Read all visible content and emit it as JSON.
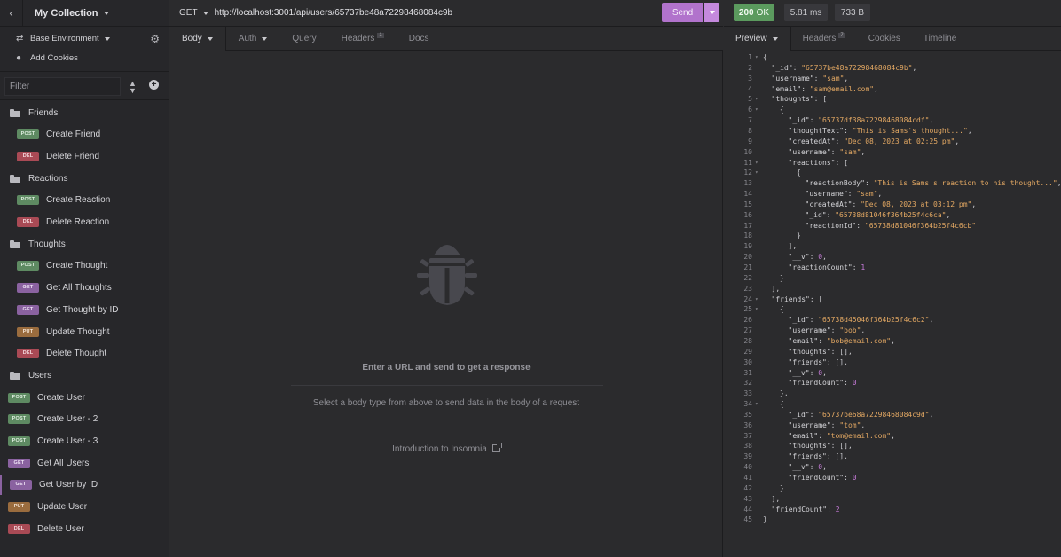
{
  "sidebar": {
    "collection_title": "My Collection",
    "environment_label": "Base Environment",
    "add_cookies_label": "Add Cookies",
    "filter_placeholder": "Filter",
    "items": [
      {
        "type": "folder",
        "label": "Friends"
      },
      {
        "type": "request",
        "method": "POST",
        "label": "Create Friend",
        "indent": true
      },
      {
        "type": "request",
        "method": "DEL",
        "label": "Delete Friend",
        "indent": true
      },
      {
        "type": "folder",
        "label": "Reactions"
      },
      {
        "type": "request",
        "method": "POST",
        "label": "Create Reaction",
        "indent": true
      },
      {
        "type": "request",
        "method": "DEL",
        "label": "Delete Reaction",
        "indent": true
      },
      {
        "type": "folder",
        "label": "Thoughts"
      },
      {
        "type": "request",
        "method": "POST",
        "label": "Create Thought",
        "indent": true
      },
      {
        "type": "request",
        "method": "GET",
        "label": "Get All Thoughts",
        "indent": true
      },
      {
        "type": "request",
        "method": "GET",
        "label": "Get Thought by ID",
        "indent": true
      },
      {
        "type": "request",
        "method": "PUT",
        "label": "Update Thought",
        "indent": true
      },
      {
        "type": "request",
        "method": "DEL",
        "label": "Delete Thought",
        "indent": true
      },
      {
        "type": "folder",
        "label": "Users"
      },
      {
        "type": "request",
        "method": "POST",
        "label": "Create User",
        "indent": false
      },
      {
        "type": "request",
        "method": "POST",
        "label": "Create User - 2",
        "indent": false
      },
      {
        "type": "request",
        "method": "POST",
        "label": "Create User - 3",
        "indent": false
      },
      {
        "type": "request",
        "method": "GET",
        "label": "Get All Users",
        "indent": false
      },
      {
        "type": "request",
        "method": "GET",
        "label": "Get User by ID",
        "indent": false,
        "active": true
      },
      {
        "type": "request",
        "method": "PUT",
        "label": "Update User",
        "indent": false
      },
      {
        "type": "request",
        "method": "DEL",
        "label": "Delete User",
        "indent": false
      }
    ]
  },
  "request": {
    "method": "GET",
    "url": "http://localhost:3001/api/users/65737be48a72298468084c9b",
    "send_label": "Send",
    "tabs": [
      {
        "label": "Body",
        "active": true,
        "dropdown": true
      },
      {
        "label": "Auth",
        "active": false,
        "dropdown": true
      },
      {
        "label": "Query",
        "active": false
      },
      {
        "label": "Headers",
        "active": false,
        "count": "1"
      },
      {
        "label": "Docs",
        "active": false
      }
    ],
    "empty_title": "Enter a URL and send to get a response",
    "empty_sub": "Select a body type from above to send data in the body of a request",
    "intro_link": "Introduction to Insomnia"
  },
  "response": {
    "status_code": "200",
    "status_text": "OK",
    "time": "5.81 ms",
    "size": "733 B",
    "tabs": [
      {
        "label": "Preview",
        "active": true,
        "dropdown": true
      },
      {
        "label": "Headers",
        "active": false,
        "count": "7"
      },
      {
        "label": "Cookies",
        "active": false
      },
      {
        "label": "Timeline",
        "active": false
      }
    ],
    "lines": [
      {
        "n": 1,
        "fold": true,
        "ind": 0,
        "parts": [
          [
            "p",
            "{"
          ]
        ]
      },
      {
        "n": 2,
        "ind": 1,
        "parts": [
          [
            "k",
            "\"_id\""
          ],
          [
            "p",
            ": "
          ],
          [
            "s",
            "\"65737be48a72298468084c9b\""
          ],
          [
            "p",
            ","
          ]
        ]
      },
      {
        "n": 3,
        "ind": 1,
        "parts": [
          [
            "k",
            "\"username\""
          ],
          [
            "p",
            ": "
          ],
          [
            "s",
            "\"sam\""
          ],
          [
            "p",
            ","
          ]
        ]
      },
      {
        "n": 4,
        "ind": 1,
        "parts": [
          [
            "k",
            "\"email\""
          ],
          [
            "p",
            ": "
          ],
          [
            "s",
            "\"sam@email.com\""
          ],
          [
            "p",
            ","
          ]
        ]
      },
      {
        "n": 5,
        "fold": true,
        "ind": 1,
        "parts": [
          [
            "k",
            "\"thoughts\""
          ],
          [
            "p",
            ": ["
          ]
        ]
      },
      {
        "n": 6,
        "fold": true,
        "ind": 2,
        "parts": [
          [
            "p",
            "{"
          ]
        ]
      },
      {
        "n": 7,
        "ind": 3,
        "parts": [
          [
            "k",
            "\"_id\""
          ],
          [
            "p",
            ": "
          ],
          [
            "s",
            "\"65737df38a72298468084cdf\""
          ],
          [
            "p",
            ","
          ]
        ]
      },
      {
        "n": 8,
        "ind": 3,
        "parts": [
          [
            "k",
            "\"thoughtText\""
          ],
          [
            "p",
            ": "
          ],
          [
            "s",
            "\"This is Sams's thought...\""
          ],
          [
            "p",
            ","
          ]
        ]
      },
      {
        "n": 9,
        "ind": 3,
        "parts": [
          [
            "k",
            "\"createdAt\""
          ],
          [
            "p",
            ": "
          ],
          [
            "s",
            "\"Dec 08, 2023 at 02:25 pm\""
          ],
          [
            "p",
            ","
          ]
        ]
      },
      {
        "n": 10,
        "ind": 3,
        "parts": [
          [
            "k",
            "\"username\""
          ],
          [
            "p",
            ": "
          ],
          [
            "s",
            "\"sam\""
          ],
          [
            "p",
            ","
          ]
        ]
      },
      {
        "n": 11,
        "fold": true,
        "ind": 3,
        "parts": [
          [
            "k",
            "\"reactions\""
          ],
          [
            "p",
            ": ["
          ]
        ]
      },
      {
        "n": 12,
        "fold": true,
        "ind": 4,
        "parts": [
          [
            "p",
            "{"
          ]
        ]
      },
      {
        "n": 13,
        "ind": 5,
        "parts": [
          [
            "k",
            "\"reactionBody\""
          ],
          [
            "p",
            ": "
          ],
          [
            "s",
            "\"This is Sams's reaction to his thought...\""
          ],
          [
            "p",
            ","
          ]
        ]
      },
      {
        "n": 14,
        "ind": 5,
        "parts": [
          [
            "k",
            "\"username\""
          ],
          [
            "p",
            ": "
          ],
          [
            "s",
            "\"sam\""
          ],
          [
            "p",
            ","
          ]
        ]
      },
      {
        "n": 15,
        "ind": 5,
        "parts": [
          [
            "k",
            "\"createdAt\""
          ],
          [
            "p",
            ": "
          ],
          [
            "s",
            "\"Dec 08, 2023 at 03:12 pm\""
          ],
          [
            "p",
            ","
          ]
        ]
      },
      {
        "n": 16,
        "ind": 5,
        "parts": [
          [
            "k",
            "\"_id\""
          ],
          [
            "p",
            ": "
          ],
          [
            "s",
            "\"65738d81046f364b25f4c6ca\""
          ],
          [
            "p",
            ","
          ]
        ]
      },
      {
        "n": 17,
        "ind": 5,
        "parts": [
          [
            "k",
            "\"reactionId\""
          ],
          [
            "p",
            ": "
          ],
          [
            "s",
            "\"65738d81046f364b25f4c6cb\""
          ]
        ]
      },
      {
        "n": 18,
        "ind": 4,
        "parts": [
          [
            "p",
            "}"
          ]
        ]
      },
      {
        "n": 19,
        "ind": 3,
        "parts": [
          [
            "p",
            "],"
          ]
        ]
      },
      {
        "n": 20,
        "ind": 3,
        "parts": [
          [
            "k",
            "\"__v\""
          ],
          [
            "p",
            ": "
          ],
          [
            "n",
            "0"
          ],
          [
            "p",
            ","
          ]
        ]
      },
      {
        "n": 21,
        "ind": 3,
        "parts": [
          [
            "k",
            "\"reactionCount\""
          ],
          [
            "p",
            ": "
          ],
          [
            "n",
            "1"
          ]
        ]
      },
      {
        "n": 22,
        "ind": 2,
        "parts": [
          [
            "p",
            "}"
          ]
        ]
      },
      {
        "n": 23,
        "ind": 1,
        "parts": [
          [
            "p",
            "],"
          ]
        ]
      },
      {
        "n": 24,
        "fold": true,
        "ind": 1,
        "parts": [
          [
            "k",
            "\"friends\""
          ],
          [
            "p",
            ": ["
          ]
        ]
      },
      {
        "n": 25,
        "fold": true,
        "ind": 2,
        "parts": [
          [
            "p",
            "{"
          ]
        ]
      },
      {
        "n": 26,
        "ind": 3,
        "parts": [
          [
            "k",
            "\"_id\""
          ],
          [
            "p",
            ": "
          ],
          [
            "s",
            "\"65738d45046f364b25f4c6c2\""
          ],
          [
            "p",
            ","
          ]
        ]
      },
      {
        "n": 27,
        "ind": 3,
        "parts": [
          [
            "k",
            "\"username\""
          ],
          [
            "p",
            ": "
          ],
          [
            "s",
            "\"bob\""
          ],
          [
            "p",
            ","
          ]
        ]
      },
      {
        "n": 28,
        "ind": 3,
        "parts": [
          [
            "k",
            "\"email\""
          ],
          [
            "p",
            ": "
          ],
          [
            "s",
            "\"bob@email.com\""
          ],
          [
            "p",
            ","
          ]
        ]
      },
      {
        "n": 29,
        "ind": 3,
        "parts": [
          [
            "k",
            "\"thoughts\""
          ],
          [
            "p",
            ": [],"
          ]
        ]
      },
      {
        "n": 30,
        "ind": 3,
        "parts": [
          [
            "k",
            "\"friends\""
          ],
          [
            "p",
            ": [],"
          ]
        ]
      },
      {
        "n": 31,
        "ind": 3,
        "parts": [
          [
            "k",
            "\"__v\""
          ],
          [
            "p",
            ": "
          ],
          [
            "n",
            "0"
          ],
          [
            "p",
            ","
          ]
        ]
      },
      {
        "n": 32,
        "ind": 3,
        "parts": [
          [
            "k",
            "\"friendCount\""
          ],
          [
            "p",
            ": "
          ],
          [
            "n",
            "0"
          ]
        ]
      },
      {
        "n": 33,
        "ind": 2,
        "parts": [
          [
            "p",
            "},"
          ]
        ]
      },
      {
        "n": 34,
        "fold": true,
        "ind": 2,
        "parts": [
          [
            "p",
            "{"
          ]
        ]
      },
      {
        "n": 35,
        "ind": 3,
        "parts": [
          [
            "k",
            "\"_id\""
          ],
          [
            "p",
            ": "
          ],
          [
            "s",
            "\"65737be68a72298468084c9d\""
          ],
          [
            "p",
            ","
          ]
        ]
      },
      {
        "n": 36,
        "ind": 3,
        "parts": [
          [
            "k",
            "\"username\""
          ],
          [
            "p",
            ": "
          ],
          [
            "s",
            "\"tom\""
          ],
          [
            "p",
            ","
          ]
        ]
      },
      {
        "n": 37,
        "ind": 3,
        "parts": [
          [
            "k",
            "\"email\""
          ],
          [
            "p",
            ": "
          ],
          [
            "s",
            "\"tom@email.com\""
          ],
          [
            "p",
            ","
          ]
        ]
      },
      {
        "n": 38,
        "ind": 3,
        "parts": [
          [
            "k",
            "\"thoughts\""
          ],
          [
            "p",
            ": [],"
          ]
        ]
      },
      {
        "n": 39,
        "ind": 3,
        "parts": [
          [
            "k",
            "\"friends\""
          ],
          [
            "p",
            ": [],"
          ]
        ]
      },
      {
        "n": 40,
        "ind": 3,
        "parts": [
          [
            "k",
            "\"__v\""
          ],
          [
            "p",
            ": "
          ],
          [
            "n",
            "0"
          ],
          [
            "p",
            ","
          ]
        ]
      },
      {
        "n": 41,
        "ind": 3,
        "parts": [
          [
            "k",
            "\"friendCount\""
          ],
          [
            "p",
            ": "
          ],
          [
            "n",
            "0"
          ]
        ]
      },
      {
        "n": 42,
        "ind": 2,
        "parts": [
          [
            "p",
            "}"
          ]
        ]
      },
      {
        "n": 43,
        "ind": 1,
        "parts": [
          [
            "p",
            "],"
          ]
        ]
      },
      {
        "n": 44,
        "ind": 1,
        "parts": [
          [
            "k",
            "\"friendCount\""
          ],
          [
            "p",
            ": "
          ],
          [
            "n",
            "2"
          ]
        ]
      },
      {
        "n": 45,
        "ind": 0,
        "parts": [
          [
            "p",
            "}"
          ]
        ]
      }
    ]
  },
  "colors": {
    "accent": "#b173cc",
    "status_ok": "#5b9a5e",
    "post": "#5e8a62",
    "get": "#8a62a0",
    "put": "#9a6c3e",
    "del": "#a94a55",
    "json_string": "#e3a863",
    "json_number": "#c77bd9"
  },
  "icons": {
    "back": "chevron-left-icon",
    "environment": "swap-icon",
    "cookies": "cookie-icon",
    "settings": "gear-icon",
    "sort": "sort-icon",
    "add": "plus-circle-icon",
    "folder": "folder-icon",
    "empty_state": "bug-icon",
    "external_link": "external-link-icon"
  }
}
